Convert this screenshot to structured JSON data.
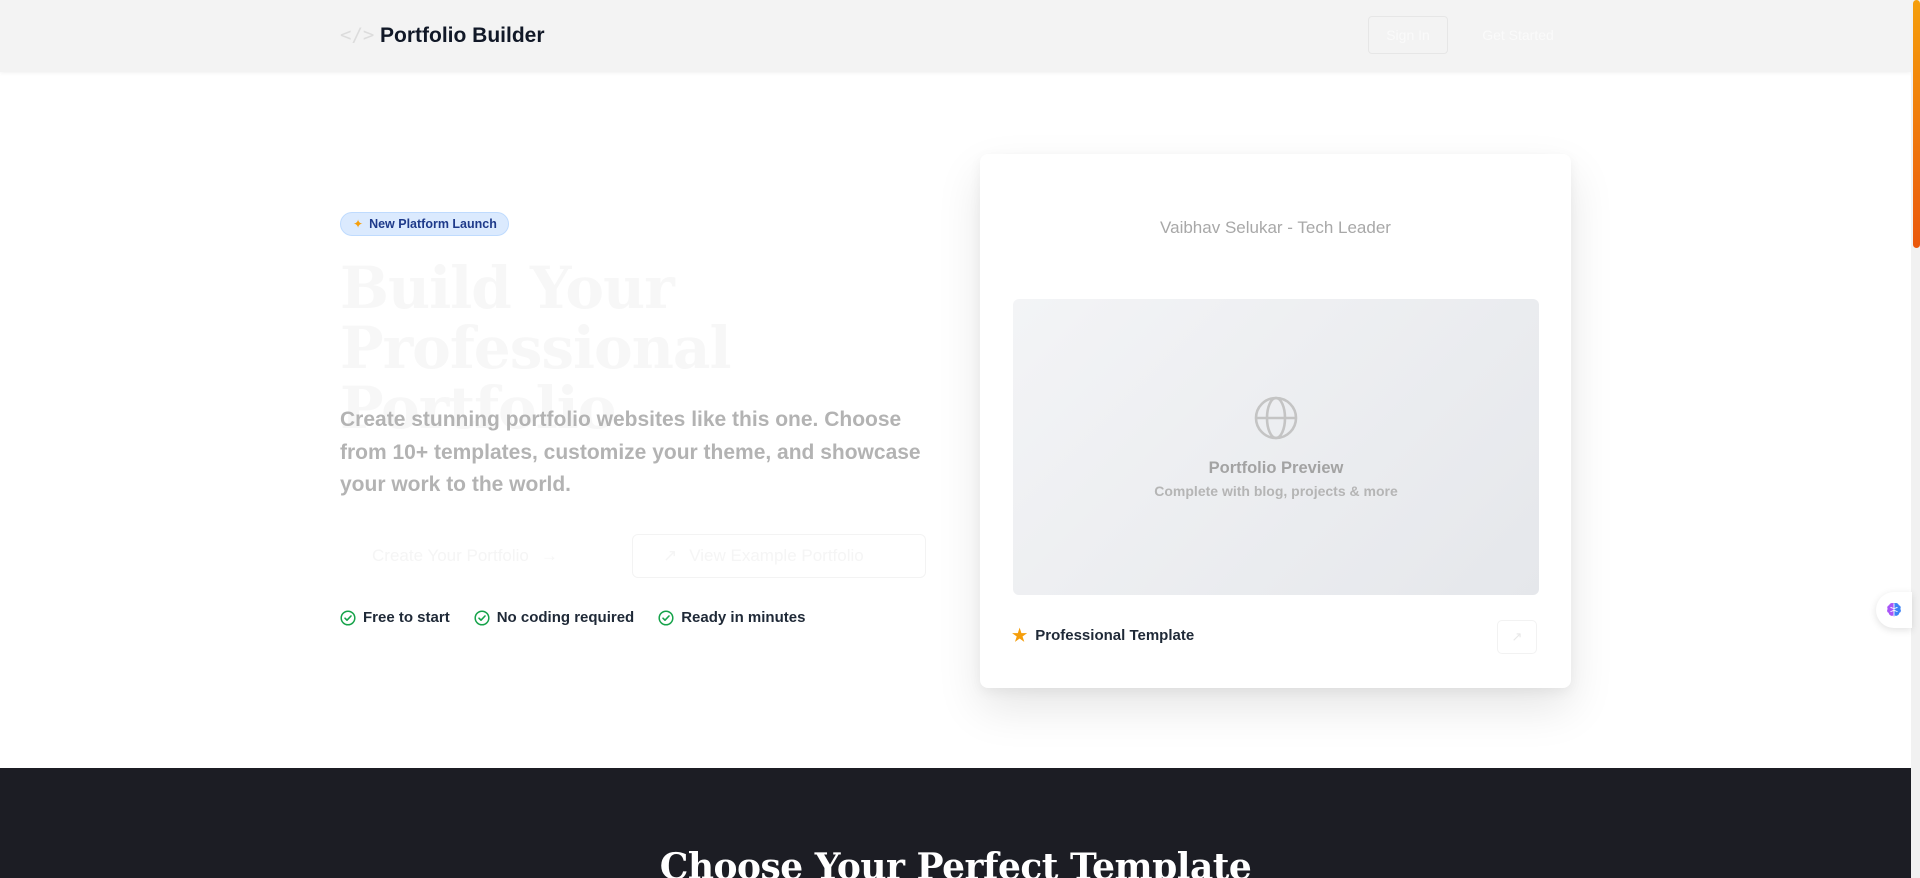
{
  "header": {
    "brand": "Portfolio Builder",
    "logo_icon": "code-icon",
    "signin_label": "Sign In",
    "getstarted_label": "Get Started"
  },
  "hero": {
    "badge_label": "New Platform Launch",
    "title_line1": "Build Your",
    "title_line2": "Professional Portfolio",
    "subtitle": "Create stunning portfolio websites like this one. Choose from 10+ templates, customize your theme, and showcase your work to the world.",
    "create_button_label": "Create Your Portfolio",
    "view_button_label": "View Example Portfolio",
    "features": [
      "Free to start",
      "No coding required",
      "Ready in minutes"
    ]
  },
  "card": {
    "title": "Vaibhav Selukar - Tech Leader",
    "preview_title": "Portfolio Preview",
    "preview_subtitle": "Complete with blog, projects & more",
    "footer_label": "Professional Template"
  },
  "section2": {
    "title": "Choose Your Perfect Template"
  },
  "colors": {
    "accent_orange": "#f59e0b",
    "badge_bg": "#dbeafe",
    "badge_text": "#1e3a8a",
    "check_green": "#16a34a",
    "dark_section": "#1c1d24"
  }
}
